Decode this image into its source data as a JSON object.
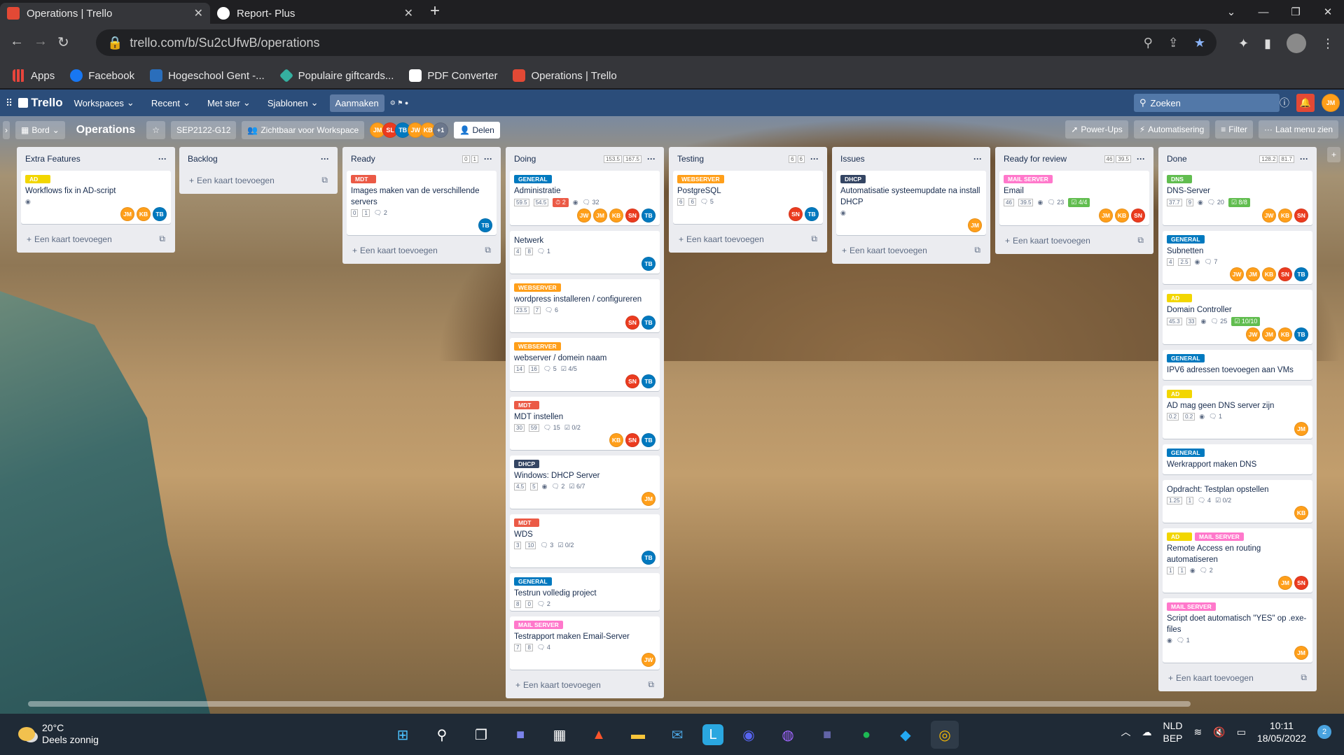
{
  "browser": {
    "tabs": [
      {
        "title": "Operations | Trello",
        "active": true
      },
      {
        "title": "Report- Plus",
        "active": false
      }
    ],
    "url": "trello.com/b/Su2cUfwB/operations",
    "bookmarks": [
      "Apps",
      "Facebook",
      "Hogeschool Gent -...",
      "Populaire giftcards...",
      "PDF Converter",
      "Operations | Trello"
    ]
  },
  "trello_header": {
    "logo": "Trello",
    "menus": [
      "Workspaces",
      "Recent",
      "Met ster",
      "Sjablonen"
    ],
    "create": "Aanmaken",
    "search": "Zoeken",
    "user": "JM"
  },
  "board_bar": {
    "view": "Bord",
    "title": "Operations",
    "workspace": "SEP2122-G12",
    "visibility": "Zichtbaar voor Workspace",
    "extra_members": "+1",
    "share": "Delen",
    "powerups": "Power-Ups",
    "automation": "Automatisering",
    "filter": "Filter",
    "menu": "Laat menu zien"
  },
  "add_card": "Een kaart toevoegen",
  "lists": [
    {
      "name": "Extra Features",
      "limits": [],
      "cards": [
        {
          "labels": [
            {
              "t": "AD",
              "c": "#f2d600"
            }
          ],
          "title": "Workflows fix in AD-script",
          "badges": {
            "watch": true
          },
          "members": [
            "JM",
            "KB",
            "TB"
          ]
        }
      ]
    },
    {
      "name": "Backlog",
      "limits": [],
      "cards": []
    },
    {
      "name": "Ready",
      "limits": [
        "0",
        "1"
      ],
      "cards": [
        {
          "labels": [
            {
              "t": "MDT",
              "c": "#eb5a46"
            }
          ],
          "title": "Images maken van de verschillende servers",
          "badges": {
            "pts": [
              "0",
              "1"
            ],
            "comments": "2"
          },
          "members": [
            "TB"
          ]
        }
      ]
    },
    {
      "name": "Doing",
      "limits": [
        "153.5",
        "167.5"
      ],
      "cards": [
        {
          "labels": [
            {
              "t": "General",
              "c": "#0079bf"
            }
          ],
          "title": "Administratie",
          "badges": {
            "pts": [
              "59.5",
              "54.5"
            ],
            "due": "2",
            "watch": true,
            "comments": "32"
          },
          "members": [
            "JW",
            "JM",
            "KB",
            "SN",
            "TB"
          ]
        },
        {
          "labels": [],
          "title": "Netwerk",
          "badges": {
            "pts": [
              "4",
              "8"
            ],
            "comments": "1"
          },
          "members": [
            "TB"
          ]
        },
        {
          "labels": [
            {
              "t": "WEBSERVER",
              "c": "#ff9f1a"
            }
          ],
          "title": "wordpress installeren / configureren",
          "badges": {
            "pts": [
              "23.5",
              "7"
            ],
            "comments": "6"
          },
          "members": [
            "SN",
            "TB"
          ]
        },
        {
          "labels": [
            {
              "t": "WEBSERVER",
              "c": "#ff9f1a"
            }
          ],
          "title": "webserver / domein naam",
          "badges": {
            "pts": [
              "14",
              "16"
            ],
            "comments": "5",
            "check": "4/5"
          },
          "members": [
            "SN",
            "TB"
          ]
        },
        {
          "labels": [
            {
              "t": "MDT",
              "c": "#eb5a46"
            }
          ],
          "title": "MDT instellen",
          "badges": {
            "pts": [
              "30",
              "59"
            ],
            "comments": "15",
            "check": "0/2"
          },
          "members": [
            "KB",
            "SN",
            "TB"
          ]
        },
        {
          "labels": [
            {
              "t": "DHCP",
              "c": "#344563"
            }
          ],
          "title": "Windows: DHCP Server",
          "badges": {
            "pts": [
              "4.5",
              "5"
            ],
            "watch": true,
            "comments": "2",
            "check": "6/7"
          },
          "members": [
            "JM"
          ]
        },
        {
          "labels": [
            {
              "t": "MDT",
              "c": "#eb5a46"
            }
          ],
          "title": "WDS",
          "badges": {
            "pts": [
              "3",
              "10"
            ],
            "comments": "3",
            "check": "0/2"
          },
          "members": [
            "TB"
          ]
        },
        {
          "labels": [
            {
              "t": "General",
              "c": "#0079bf"
            }
          ],
          "title": "Testrun volledig project",
          "badges": {
            "pts": [
              "8",
              "0"
            ],
            "comments": "2"
          },
          "members": []
        },
        {
          "labels": [
            {
              "t": "MAIL SERVER",
              "c": "#ff78cb"
            }
          ],
          "title": "Testrapport maken Email-Server",
          "badges": {
            "pts": [
              "7",
              "8"
            ],
            "comments": "4"
          },
          "members": [
            "JW"
          ]
        }
      ]
    },
    {
      "name": "Testing",
      "limits": [
        "6",
        "6"
      ],
      "cards": [
        {
          "labels": [
            {
              "t": "WEBSERVER",
              "c": "#ff9f1a"
            }
          ],
          "title": "PostgreSQL",
          "badges": {
            "pts": [
              "6",
              "6"
            ],
            "comments": "5"
          },
          "members": [
            "SN",
            "TB"
          ]
        }
      ]
    },
    {
      "name": "Issues",
      "limits": [],
      "cards": [
        {
          "labels": [
            {
              "t": "DHCP",
              "c": "#344563"
            }
          ],
          "title": "Automatisatie systeemupdate na install DHCP",
          "badges": {
            "watch": true
          },
          "members": [
            "JM"
          ]
        }
      ]
    },
    {
      "name": "Ready for review",
      "limits": [
        "46",
        "39.5"
      ],
      "cards": [
        {
          "labels": [
            {
              "t": "MAIL SERVER",
              "c": "#ff78cb"
            }
          ],
          "title": "Email",
          "badges": {
            "pts": [
              "46",
              "39.5"
            ],
            "watch": true,
            "comments": "23",
            "checkdone": "4/4"
          },
          "members": [
            "JM",
            "KB",
            "SN"
          ]
        }
      ]
    },
    {
      "name": "Done",
      "limits": [
        "128.2",
        "81.7"
      ],
      "cards": [
        {
          "labels": [
            {
              "t": "DNS",
              "c": "#61bd4f"
            }
          ],
          "title": "DNS-Server",
          "badges": {
            "pts": [
              "37.7",
              "9"
            ],
            "watch": true,
            "comments": "20",
            "checkdone": "8/8"
          },
          "members": [
            "JW",
            "KB",
            "SN"
          ]
        },
        {
          "labels": [
            {
              "t": "General",
              "c": "#0079bf"
            }
          ],
          "title": "Subnetten",
          "badges": {
            "pts": [
              "4",
              "2.5"
            ],
            "watch": true,
            "comments": "7"
          },
          "members": [
            "JW",
            "JM",
            "KB",
            "SN",
            "TB"
          ]
        },
        {
          "labels": [
            {
              "t": "AD",
              "c": "#f2d600"
            }
          ],
          "title": "Domain Controller",
          "badges": {
            "pts": [
              "45.3",
              "33"
            ],
            "watch": true,
            "comments": "25",
            "checkdone": "10/10"
          },
          "members": [
            "JW",
            "JM",
            "KB",
            "TB"
          ]
        },
        {
          "labels": [
            {
              "t": "General",
              "c": "#0079bf"
            }
          ],
          "title": "IPV6 adressen toevoegen aan VMs",
          "badges": {},
          "members": []
        },
        {
          "labels": [
            {
              "t": "AD",
              "c": "#f2d600"
            }
          ],
          "title": "AD mag geen DNS server zijn",
          "badges": {
            "pts": [
              "0.2",
              "0.2"
            ],
            "watch": true,
            "comments": "1"
          },
          "members": [
            "JM"
          ]
        },
        {
          "labels": [
            {
              "t": "General",
              "c": "#0079bf"
            }
          ],
          "title": "Werkrapport maken DNS",
          "badges": {},
          "members": []
        },
        {
          "labels": [],
          "title": "Opdracht: Testplan opstellen",
          "badges": {
            "pts": [
              "1.25",
              "1"
            ],
            "comments": "4",
            "check": "0/2"
          },
          "members": [
            "KB"
          ]
        },
        {
          "labels": [
            {
              "t": "AD",
              "c": "#f2d600"
            },
            {
              "t": "MAIL SERVER",
              "c": "#ff78cb"
            }
          ],
          "title": "Remote Access en routing automatiseren",
          "badges": {
            "pts": [
              "1",
              "1"
            ],
            "watch": true,
            "comments": "2"
          },
          "members": [
            "JM",
            "SN"
          ]
        },
        {
          "labels": [
            {
              "t": "MAIL SERVER",
              "c": "#ff78cb"
            }
          ],
          "title": "Script doet automatisch \"YES\" op .exe-files",
          "badges": {
            "watch": true,
            "comments": "1"
          },
          "members": [
            "JM"
          ]
        }
      ]
    }
  ],
  "member_colors": {
    "JM": "#ff9f1a",
    "KB": "#ff9f1a",
    "TB": "#0079bf",
    "SN": "#eb3b1f",
    "JW": "#ff9f1a",
    "SL": "#eb3b1f"
  },
  "taskbar": {
    "weather_temp": "20°C",
    "weather_desc": "Deels zonnig",
    "lang1": "NLD",
    "lang2": "BEP",
    "time": "10:11",
    "date": "18/05/2022",
    "notifications": "2"
  }
}
